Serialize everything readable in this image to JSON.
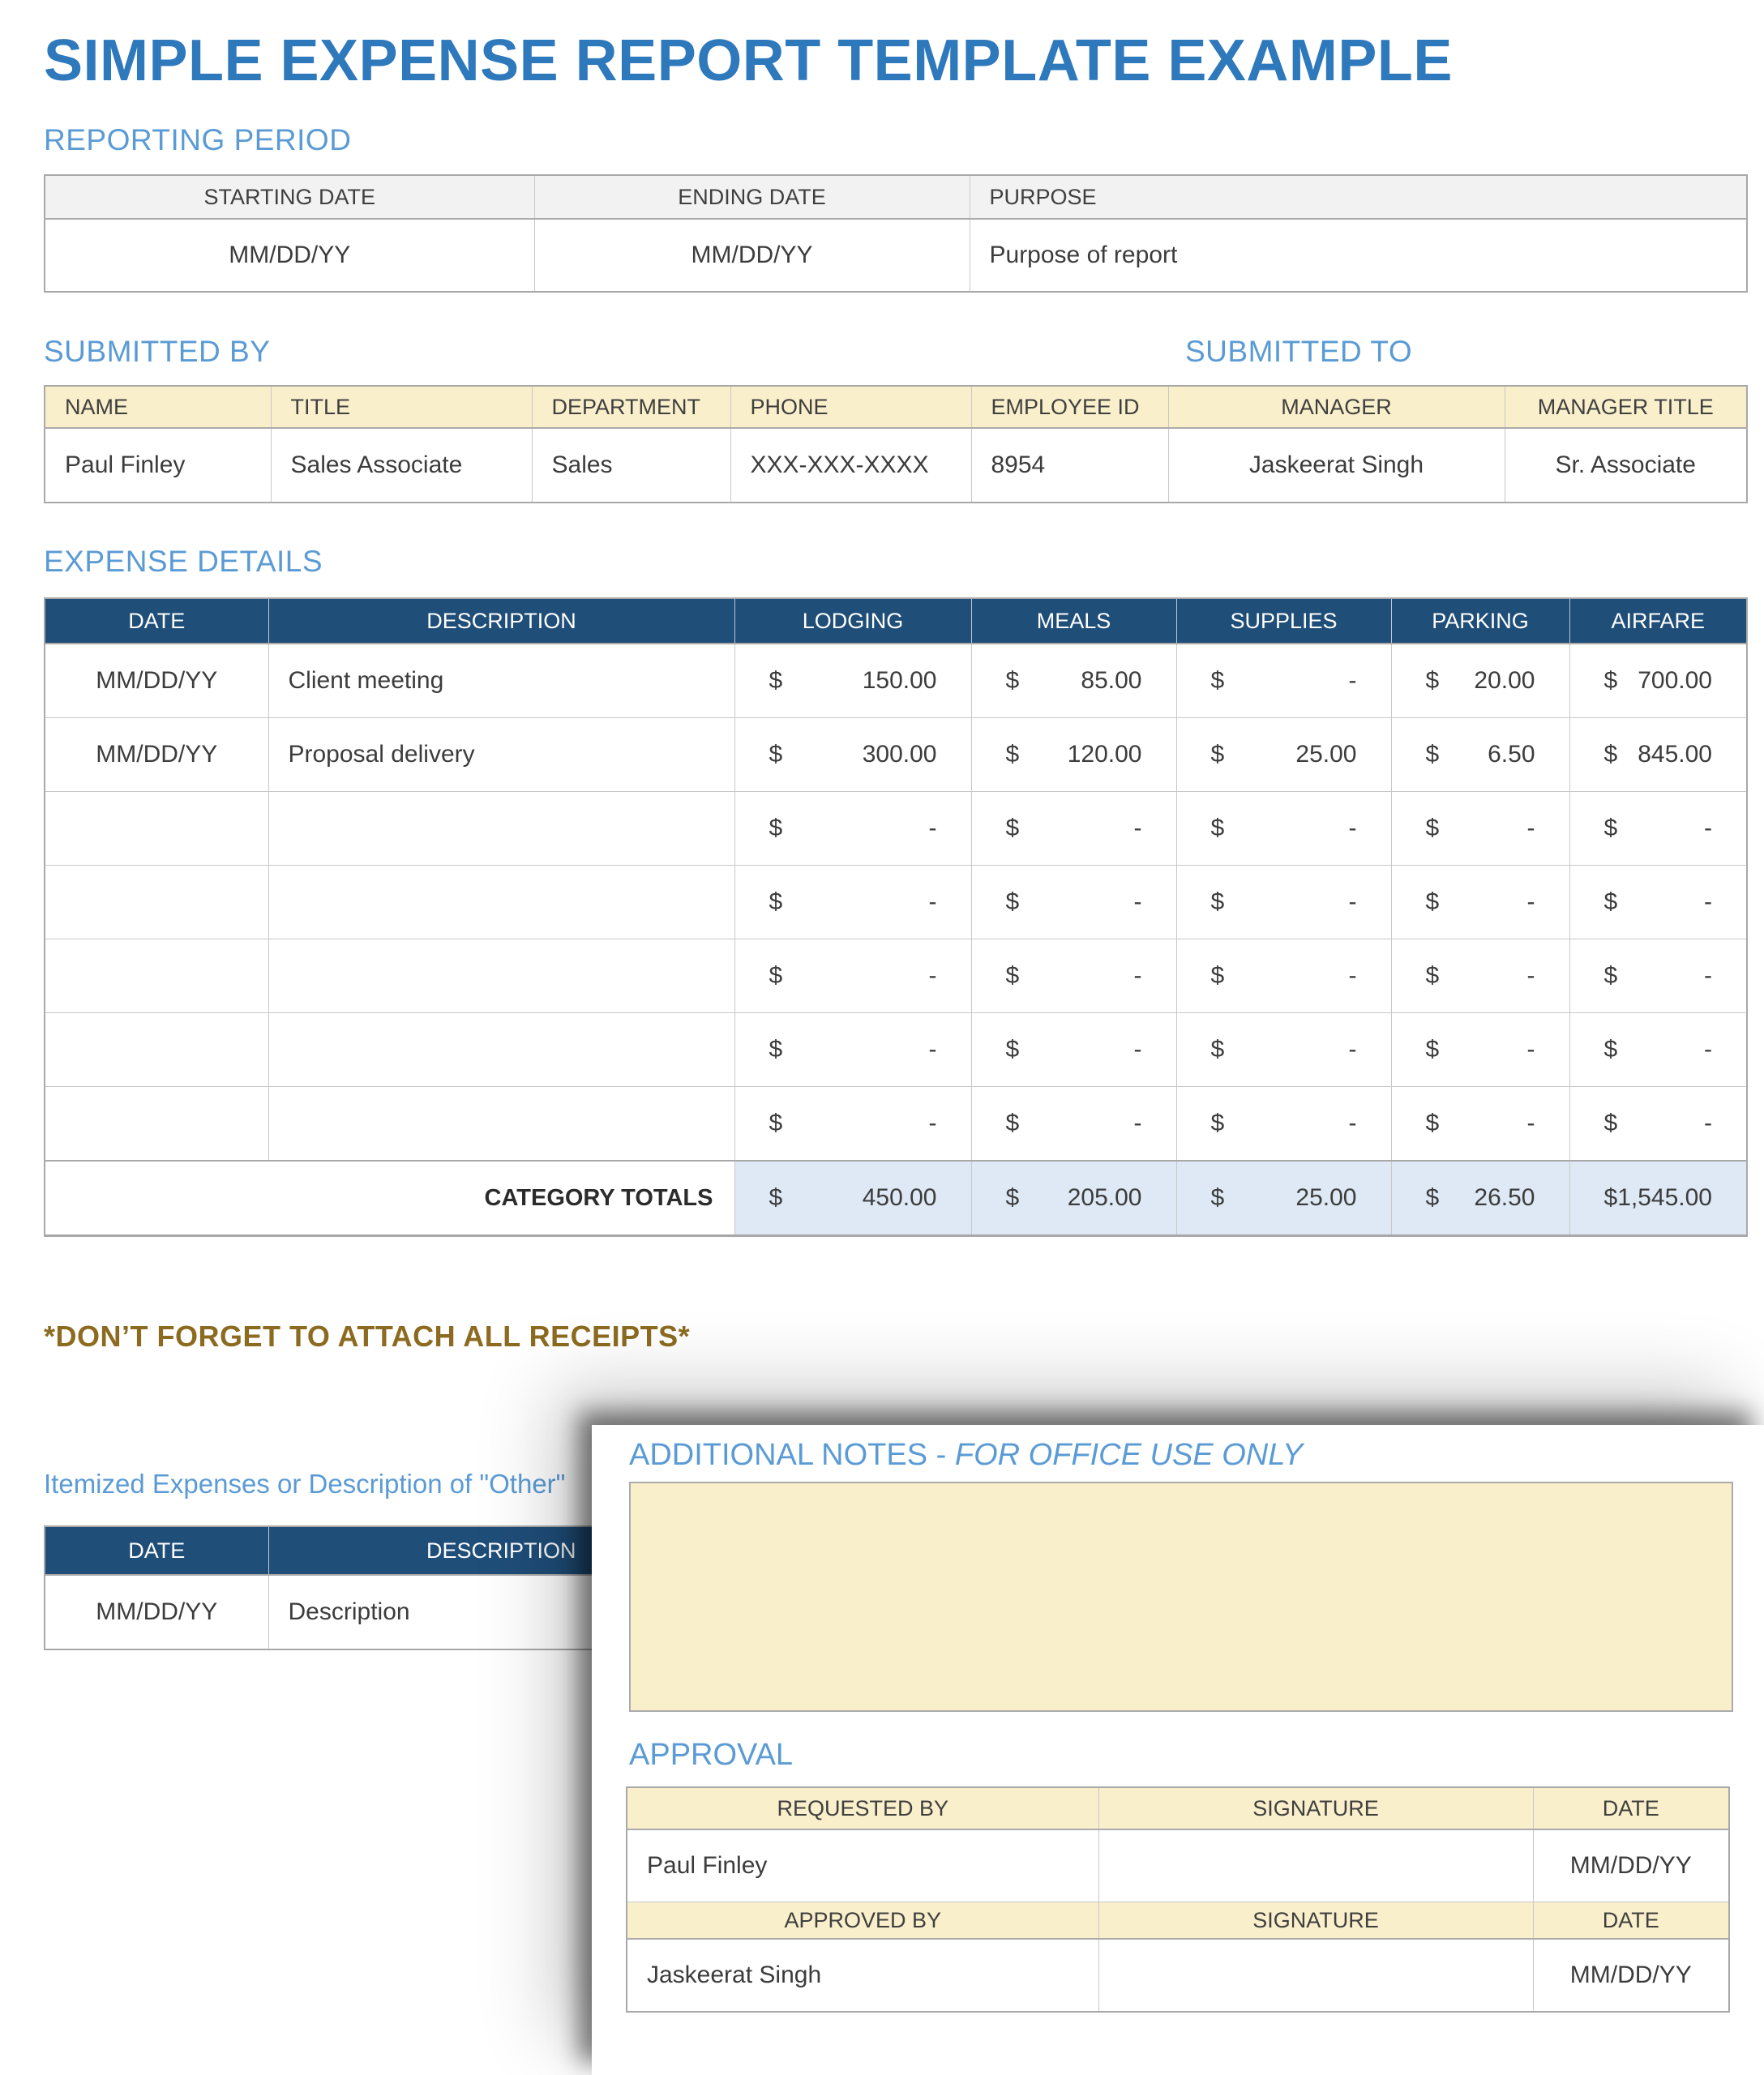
{
  "page": {
    "title": "SIMPLE EXPENSE REPORT TEMPLATE EXAMPLE"
  },
  "currency": "$",
  "reporting_period": {
    "heading": "REPORTING PERIOD",
    "headers": {
      "starting": "STARTING DATE",
      "ending": "ENDING DATE",
      "purpose": "PURPOSE"
    },
    "values": {
      "starting": "MM/DD/YY",
      "ending": "MM/DD/YY",
      "purpose": "Purpose of report"
    }
  },
  "submitted": {
    "by_heading": "SUBMITTED BY",
    "to_heading": "SUBMITTED TO",
    "headers": [
      "NAME",
      "TITLE",
      "DEPARTMENT",
      "PHONE",
      "EMPLOYEE ID",
      "MANAGER",
      "MANAGER TITLE"
    ],
    "values": [
      "Paul Finley",
      "Sales Associate",
      "Sales",
      "XXX-XXX-XXXX",
      "8954",
      "Jaskeerat Singh",
      "Sr. Associate"
    ]
  },
  "expense": {
    "heading": "EXPENSE DETAILS",
    "headers": [
      "DATE",
      "DESCRIPTION",
      "LODGING",
      "MEALS",
      "SUPPLIES",
      "PARKING",
      "AIRFARE"
    ],
    "rows": [
      {
        "date": "MM/DD/YY",
        "description": "Client meeting",
        "lodging": "150.00",
        "meals": "85.00",
        "supplies": "-",
        "parking": "20.00",
        "airfare": "700.00"
      },
      {
        "date": "MM/DD/YY",
        "description": "Proposal delivery",
        "lodging": "300.00",
        "meals": "120.00",
        "supplies": "25.00",
        "parking": "6.50",
        "airfare": "845.00"
      },
      {
        "date": "",
        "description": "",
        "lodging": "-",
        "meals": "-",
        "supplies": "-",
        "parking": "-",
        "airfare": "-"
      },
      {
        "date": "",
        "description": "",
        "lodging": "-",
        "meals": "-",
        "supplies": "-",
        "parking": "-",
        "airfare": "-"
      },
      {
        "date": "",
        "description": "",
        "lodging": "-",
        "meals": "-",
        "supplies": "-",
        "parking": "-",
        "airfare": "-"
      },
      {
        "date": "",
        "description": "",
        "lodging": "-",
        "meals": "-",
        "supplies": "-",
        "parking": "-",
        "airfare": "-"
      },
      {
        "date": "",
        "description": "",
        "lodging": "-",
        "meals": "-",
        "supplies": "-",
        "parking": "-",
        "airfare": "-"
      }
    ],
    "totals": {
      "label": "CATEGORY TOTALS",
      "lodging": "450.00",
      "meals": "205.00",
      "supplies": "25.00",
      "parking": "26.50",
      "airfare": "1,545.00"
    }
  },
  "receipts_note": "*DON’T FORGET TO ATTACH ALL RECEIPTS*",
  "itemized": {
    "heading": "Itemized Expenses or Description of \"Other\"",
    "headers": {
      "date": "DATE",
      "description": "DESCRIPTION"
    },
    "row": {
      "date": "MM/DD/YY",
      "description": "Description"
    }
  },
  "overlay": {
    "notes_heading_main": "ADDITIONAL NOTES - ",
    "notes_heading_italic": "FOR OFFICE USE ONLY",
    "approval_heading": "APPROVAL",
    "approval": {
      "requested_header": {
        "by": "REQUESTED BY",
        "signature": "SIGNATURE",
        "date": "DATE"
      },
      "requested_row": {
        "name": "Paul Finley",
        "signature": "",
        "date": "MM/DD/YY"
      },
      "approved_header": {
        "by": "APPROVED BY",
        "signature": "SIGNATURE",
        "date": "DATE"
      },
      "approved_row": {
        "name": "Jaskeerat Singh",
        "signature": "",
        "date": "MM/DD/YY"
      }
    }
  },
  "colors": {
    "title_blue": "#2E78BC",
    "section_blue": "#5B9BD5",
    "header_navy": "#1F4E79",
    "cream": "#FAEFCB",
    "totals_blue": "#DEE9F5",
    "header_gray": "#F2F2F2",
    "receipts_gold": "#8C6B20"
  }
}
